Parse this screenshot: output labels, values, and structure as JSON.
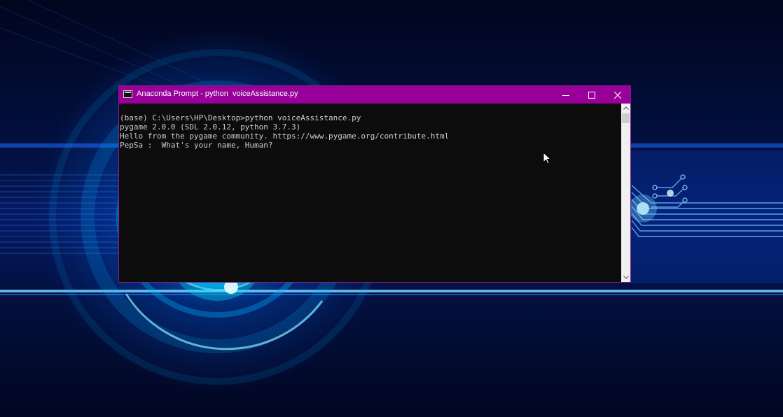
{
  "window": {
    "title": "Anaconda Prompt - python  voiceAssistance.py",
    "title_bar_color": "#990099",
    "icons": {
      "app": "console-icon",
      "minimize": "minimize-icon",
      "maximize": "maximize-icon",
      "close": "close-icon"
    }
  },
  "console": {
    "lines": [
      "(base) C:\\Users\\HP\\Desktop>python voiceAssistance.py",
      "pygame 2.0.0 (SDL 2.0.12, python 3.7.3)",
      "Hello from the pygame community. https://www.pygame.org/contribute.html",
      "PepSa :  What's your name, Human?"
    ],
    "text_color": "#cccccc",
    "background_color": "#0c0c0c"
  },
  "desktop": {
    "accent_color": "#00c8ff"
  }
}
